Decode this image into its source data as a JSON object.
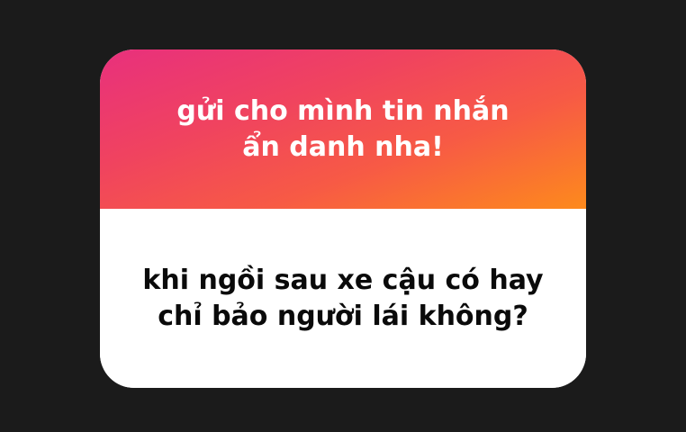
{
  "card": {
    "prompt": "gửi cho mình tin nhắn ẩn danh nha!",
    "question": "khi ngồi sau xe cậu có hay chỉ bảo người lái không?",
    "gradient_colors": [
      "#e8307d",
      "#f75a45",
      "#fd8a1c"
    ]
  }
}
